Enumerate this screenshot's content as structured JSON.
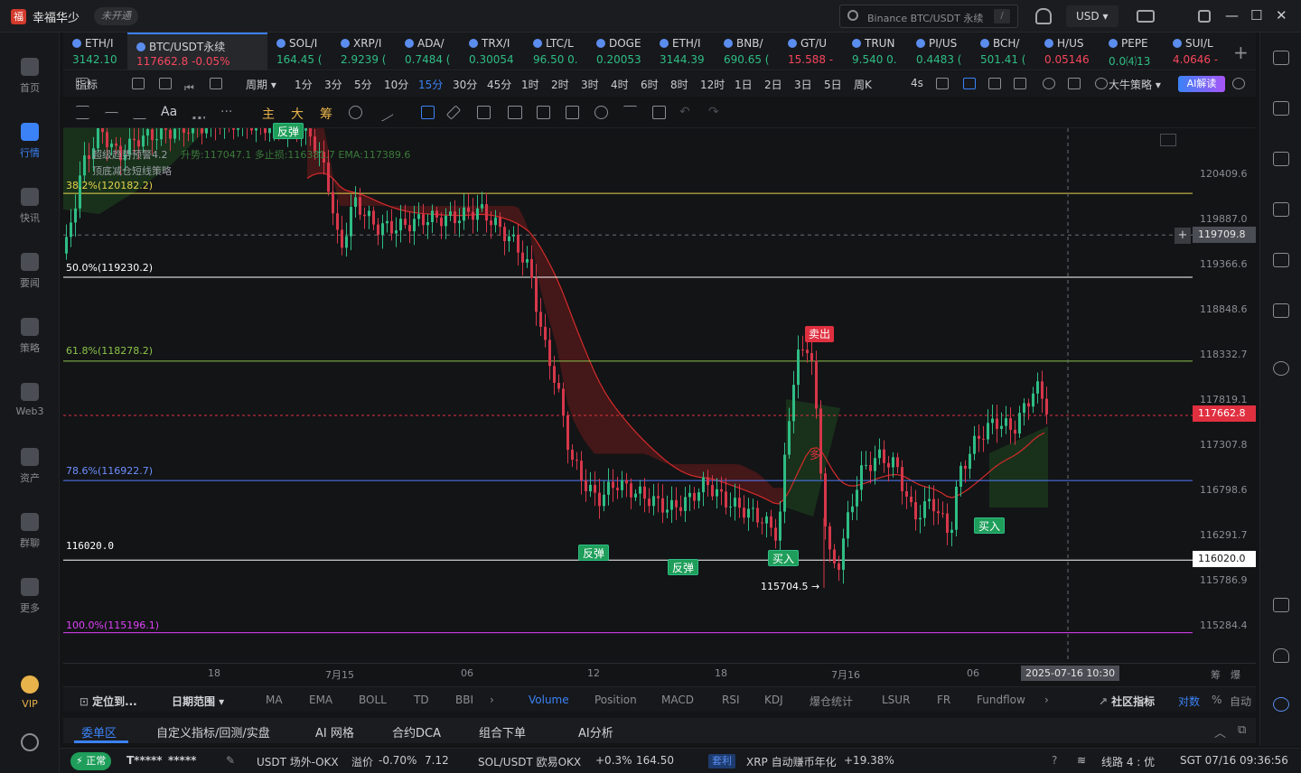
{
  "titlebar": {
    "username": "幸福华少",
    "vip_status": "未开通",
    "search_placeholder": "Binance BTC/USDT 永续",
    "search_shortcut": "/",
    "currency": "USD ▾",
    "minimize": "—",
    "maximize": "☐",
    "close": "✕"
  },
  "sidebar": {
    "items": [
      {
        "label": "首页",
        "icon": "home-icon"
      },
      {
        "label": "行情",
        "icon": "chart-icon"
      },
      {
        "label": "快讯",
        "icon": "news-icon"
      },
      {
        "label": "要闻",
        "icon": "headline-icon"
      },
      {
        "label": "策略",
        "icon": "robot-icon"
      },
      {
        "label": "Web3",
        "icon": "web3-icon"
      },
      {
        "label": "资产",
        "icon": "wallet-icon"
      },
      {
        "label": "群聊",
        "icon": "chat-icon"
      },
      {
        "label": "更多",
        "icon": "grid-icon"
      }
    ],
    "vip": "VIP"
  },
  "tickers": [
    {
      "name": "ETH/I",
      "price": "3142.10",
      "dir": "up"
    },
    {
      "name": "BTC/USDT永续",
      "price": "117662.8 -0.05%",
      "dir": "dn",
      "active": true
    },
    {
      "name": "SOL/I",
      "price": "164.45 (",
      "dir": "up"
    },
    {
      "name": "XRP/I",
      "price": "2.9239 (",
      "dir": "up"
    },
    {
      "name": "ADA/",
      "price": "0.7484 (",
      "dir": "up"
    },
    {
      "name": "TRX/I",
      "price": "0.30054",
      "dir": "up"
    },
    {
      "name": "LTC/L",
      "price": "96.50 0.",
      "dir": "up"
    },
    {
      "name": "DOGE",
      "price": "0.20053",
      "dir": "up"
    },
    {
      "name": "ETH/I",
      "price": "3144.39",
      "dir": "up"
    },
    {
      "name": "BNB/",
      "price": "690.65 (",
      "dir": "up"
    },
    {
      "name": "GT/U",
      "price": "15.588 -",
      "dir": "dn"
    },
    {
      "name": "TRUN",
      "price": "9.540 0.",
      "dir": "up"
    },
    {
      "name": "PI/US",
      "price": "0.4483 (",
      "dir": "up"
    },
    {
      "name": "BCH/",
      "price": "501.41 (",
      "dir": "up"
    },
    {
      "name": "H/US",
      "price": "0.05146",
      "dir": "dn"
    },
    {
      "name": "PEPE",
      "price": "0.0⑷13",
      "dir": "up"
    },
    {
      "name": "SUI/L",
      "price": "4.0646 -",
      "dir": "dn"
    }
  ],
  "intervals": {
    "indicator": "指标",
    "period": "周期 ▾",
    "items": [
      "1分",
      "3分",
      "5分",
      "10分",
      "15分",
      "30分",
      "45分",
      "1时",
      "2时",
      "3时",
      "4时",
      "6时",
      "8时",
      "12时",
      "1日",
      "2日",
      "3日",
      "5日",
      "周K"
    ],
    "active": "15分",
    "refresh": "4s",
    "strategy": "大牛策略 ▾",
    "ai": "AI解读"
  },
  "drawtools": {
    "zhu": "主",
    "da": "大",
    "chou": "筹",
    "aa": "Aa"
  },
  "chart": {
    "indicator_line1": "超级趋势预警4.2",
    "indicator_line1_values": "升势:117047.1 多止损:116381.7 EMA:117389.6",
    "indicator_line2": "顶底减仓短线策略",
    "fib": [
      {
        "label": "38.2%(120182.2)",
        "price": 120182.2,
        "color": "#e8d44d"
      },
      {
        "label": "50.0%(119230.2)",
        "price": 119230.2,
        "color": "#ffffff"
      },
      {
        "label": "61.8%(118278.2)",
        "price": 118278.2,
        "color": "#8bc34a"
      },
      {
        "label": "78.6%(116922.7)",
        "price": 116922.7,
        "color": "#4f7cff"
      },
      {
        "label": "100.0%(115196.1)",
        "price": 115196.1,
        "color": "#e040fb"
      }
    ],
    "support_label": "116020.0",
    "price_ticks": [
      "120409.6",
      "119887.0",
      "119366.6",
      "118848.6",
      "118332.7",
      "117819.1",
      "117307.8",
      "116798.6",
      "116291.7",
      "115786.9",
      "115284.4"
    ],
    "crosshair_price": "119709.8",
    "last_price": "117662.8",
    "support_tag": "116020.0",
    "low_label": "115704.5 →",
    "signals": {
      "rebound1": "反弹",
      "rebound2": "反弹",
      "buy1": "买入",
      "buy2": "买入",
      "sell": "卖出",
      "top": "反弹",
      "hold_long": "多"
    },
    "ylim": [
      115000,
      120800
    ]
  },
  "chart_data": {
    "type": "candlestick",
    "title": "BTC/USDT永续",
    "interval": "15分",
    "x_ticks": [
      "18",
      "7月15",
      "06",
      "12",
      "18",
      "7月16",
      "06"
    ],
    "ylim": [
      115000,
      120800
    ],
    "y_ticks": [
      120409.6,
      119887.0,
      119366.6,
      118848.6,
      118332.7,
      117819.1,
      117307.8,
      116798.6,
      116291.7,
      115786.9,
      115284.4
    ],
    "last": 117662.8,
    "low": 115704.5,
    "support": 116020.0,
    "hover_time": "2025-07-16 10:30"
  },
  "timeaxis": {
    "ticks": [
      "18",
      "7月15",
      "06",
      "12",
      "18",
      "7月16",
      "06"
    ],
    "crosshair_time": "2025-07-16 10:30",
    "right1": "筹",
    "right2": "爆"
  },
  "indtabs": {
    "position_label": "定位到...",
    "date_range": "日期范围 ▾",
    "items": [
      "MA",
      "EMA",
      "BOLL",
      "TD",
      "BBI"
    ],
    "sub_items": [
      "Volume",
      "Position",
      "MACD",
      "RSI",
      "KDJ",
      "爆仓统计",
      "LSUR",
      "FR",
      "Fundflow"
    ],
    "active": "Volume",
    "community": "社区指标",
    "compare": "对数",
    "percent": "%",
    "auto": "自动"
  },
  "bottomtabs": {
    "items": [
      "委单区",
      "自定义指标/回测/实盘",
      "AI 网格",
      "合约DCA",
      "组合下单",
      "AI分析"
    ],
    "active": "委单区"
  },
  "statusbar": {
    "status": "正常",
    "account1": "T*****",
    "account2": "*****",
    "usdt_otc": "USDT 场外-OKX",
    "premium_label": "溢价",
    "premium": "-0.70%",
    "usdt_price": "7.12",
    "sol_label": "SOL/USDT 欧易OKX",
    "sol_change": "+0.3%",
    "sol_price": "164.50",
    "arb": "套利",
    "xrp_label": "XRP 自动赚币年化",
    "xrp_apr": "+19.38%",
    "line": "线路 4 : 优",
    "time": "SGT 07/16 09:36:56"
  }
}
